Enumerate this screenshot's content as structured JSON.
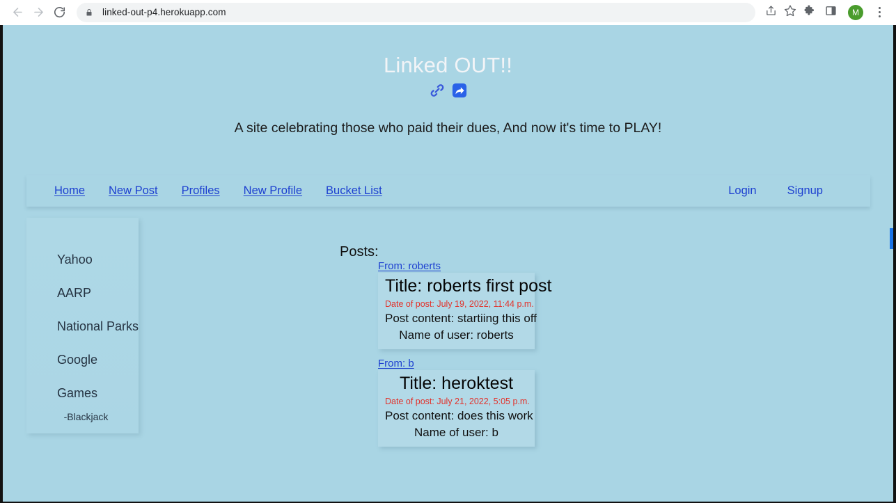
{
  "browser": {
    "back_icon": "back-arrow-icon",
    "forward_icon": "forward-arrow-icon",
    "reload_icon": "reload-icon",
    "lock_icon": "lock-icon",
    "url": "linked-out-p4.herokuapp.com",
    "share_icon": "share-icon",
    "bookmark_icon": "star-icon",
    "extensions_icon": "puzzle-piece-icon",
    "sidepanel_icon": "side-panel-icon",
    "profile_initial": "M",
    "menu_icon": "kebab-menu-icon"
  },
  "site": {
    "title": "Linked OUT!!",
    "icon_chain": "chain-link-icon",
    "icon_share": "share-arrow-icon",
    "tagline": "A site celebrating those who paid their dues, And now it's time to PLAY!",
    "colors": {
      "page_background": "#a9d5e4",
      "title_text": "#f2f4f7",
      "link": "#1c3fd0",
      "date_text": "#e2322b",
      "card_background": "#b2d9e7"
    }
  },
  "nav": {
    "left_links": [
      {
        "label": "Home"
      },
      {
        "label": "New Post"
      },
      {
        "label": "Profiles"
      },
      {
        "label": "New Profile"
      },
      {
        "label": "Bucket List"
      }
    ],
    "right_links": [
      {
        "label": "Login"
      },
      {
        "label": "Signup"
      }
    ]
  },
  "sidebar": {
    "items": [
      {
        "label": "Yahoo"
      },
      {
        "label": "AARP"
      },
      {
        "label": "National Parks"
      },
      {
        "label": "Google"
      },
      {
        "label": "Games"
      }
    ],
    "sub_items": [
      {
        "label": "-Blackjack"
      }
    ]
  },
  "main": {
    "posts_heading": "Posts:",
    "posts": [
      {
        "from": "From: roberts",
        "title": "Title: roberts first post",
        "date": "Date of post: July 19, 2022, 11:44 p.m.",
        "content": "Post content: startiing this off",
        "user": "Name of user: roberts"
      },
      {
        "from": "From: b",
        "title": "Title: heroktest",
        "date": "Date of post: July 21, 2022, 5:05 p.m.",
        "content": "Post content: does this work",
        "user": "Name of user: b"
      }
    ]
  }
}
